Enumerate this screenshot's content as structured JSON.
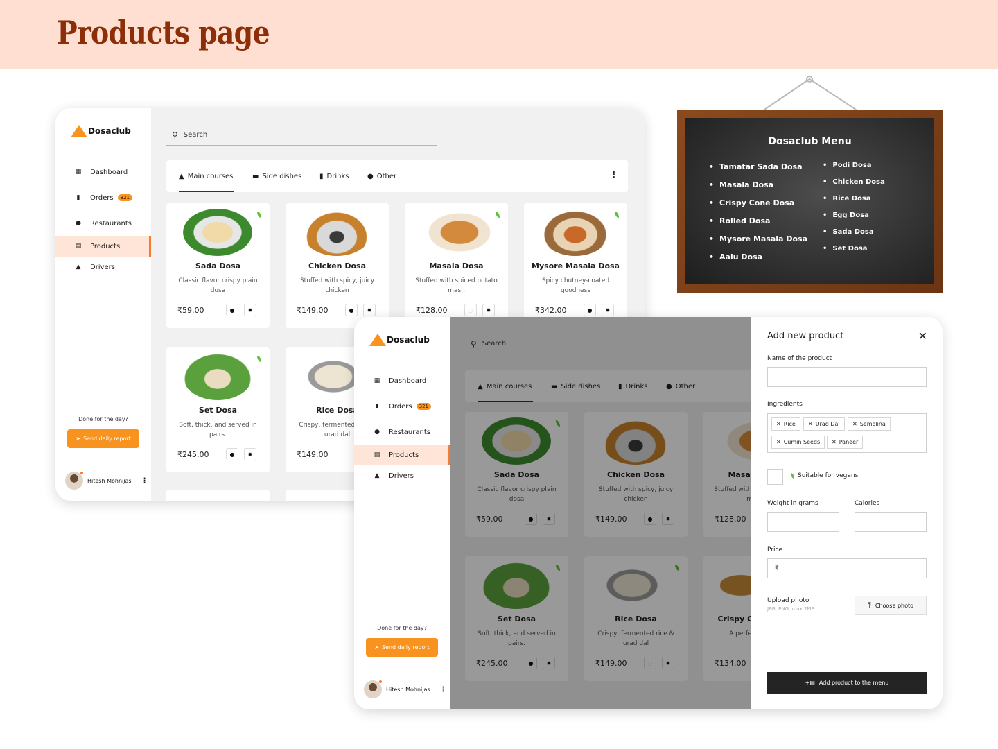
{
  "banner": {
    "title": "Products page"
  },
  "app": {
    "brand": "Dosaclub",
    "nav": [
      {
        "label": "Dashboard",
        "icon": "grid-icon"
      },
      {
        "label": "Orders",
        "icon": "receipt-icon",
        "badge": "321"
      },
      {
        "label": "Restaurants",
        "icon": "location-pin-icon"
      },
      {
        "label": "Products",
        "icon": "document-icon",
        "active": true
      },
      {
        "label": "Drivers",
        "icon": "person-icon"
      }
    ],
    "done_text": "Done for the day?",
    "report_button": "Send daily report",
    "user_name": "Hitesh Mohnijas",
    "search_placeholder": "Search",
    "tabs": [
      {
        "label": "Main courses",
        "icon": "triangle-icon",
        "active": true
      },
      {
        "label": "Side dishes",
        "icon": "bowl-icon"
      },
      {
        "label": "Drinks",
        "icon": "drink-icon"
      },
      {
        "label": "Other",
        "icon": "plate-icon"
      }
    ],
    "currency": "₹"
  },
  "products": [
    {
      "name": "Sada Dosa",
      "description": "Classic flavor crispy plain dosa",
      "price": "₹59.00",
      "vegan": true
    },
    {
      "name": "Chicken Dosa",
      "description": "Stuffed with spicy, juicy chicken",
      "price": "₹149.00",
      "vegan": false
    },
    {
      "name": "Masala Dosa",
      "description": "Stuffed with spiced potato mash",
      "price": "₹128.00",
      "vegan": true,
      "hidden": true
    },
    {
      "name": "Mysore Masala Dosa",
      "description": "Spicy chutney-coated goodness",
      "price": "₹342.00",
      "vegan": true
    },
    {
      "name": "Set Dosa",
      "description": "Soft, thick, and served in pairs.",
      "price": "₹245.00",
      "vegan": true
    },
    {
      "name": "Rice Dosa",
      "description": "Crispy, fermented rice & urad dal",
      "price": "₹149.00",
      "vegan": true,
      "hidden": true
    },
    {
      "name": "Crispy Cone Dosa",
      "description": "A perfect crunch",
      "price": "₹134.00"
    }
  ],
  "board": {
    "title": "Dosaclub Menu",
    "left_items": [
      "Tamatar Sada Dosa",
      "Masala Dosa",
      "Crispy Cone Dosa",
      "Rolled Dosa",
      "Mysore Masala Dosa",
      "Aalu Dosa"
    ],
    "right_items": [
      "Podi Dosa",
      "Chicken Dosa",
      "Rice Dosa",
      "Egg Dosa",
      "Sada Dosa",
      "Set Dosa"
    ]
  },
  "form": {
    "title": "Add new product",
    "name_label": "Name of the product",
    "ingredients_label": "Ingredients",
    "ingredients": [
      "Rice",
      "Urad Dal",
      "Semolina",
      "Cumin Seeds",
      "Paneer"
    ],
    "vegan_label": "Suitable for vegans",
    "weight_label": "Weight in grams",
    "calories_label": "Calories",
    "price_label": "Price",
    "price_prefix": "₹",
    "upload_label": "Upload photo",
    "upload_hint": "JPG, PNG, max 2MB",
    "choose_button": "Choose photo",
    "submit_button": "Add product to the menu"
  },
  "colors": {
    "accent": "#f7931e",
    "banner_bg": "#ffdfd2",
    "title": "#8c2f08",
    "active_nav_bg": "#ffe5d7"
  }
}
